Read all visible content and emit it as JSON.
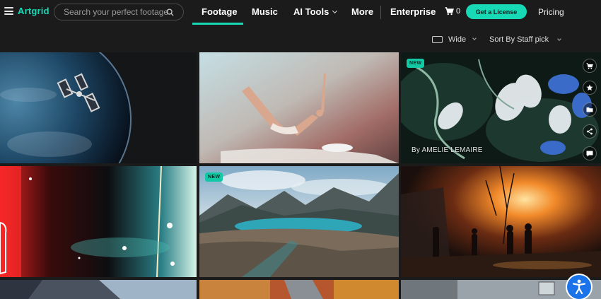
{
  "header": {
    "logo": "Artgrid",
    "search_placeholder": "Search your perfect footage",
    "nav": [
      {
        "label": "Footage",
        "active": true
      },
      {
        "label": "Music"
      },
      {
        "label": "AI Tools"
      },
      {
        "label": "More"
      },
      {
        "label": "Enterprise"
      }
    ],
    "cart_count": "0",
    "license_button": "Get a License",
    "pricing": "Pricing"
  },
  "toolbar": {
    "view_label": "Wide",
    "sort_label": "Sort By Staff pick"
  },
  "tiles": [
    {
      "name": "space-station-earth"
    },
    {
      "name": "falling-woman"
    },
    {
      "name": "flowers-underwater",
      "badge": "NEW",
      "credit": "By AMELIE LEMAIRE"
    },
    {
      "name": "film-burn"
    },
    {
      "name": "mountain-lake",
      "badge": "NEW"
    },
    {
      "name": "firefighters"
    },
    {
      "name": "building-lookup"
    },
    {
      "name": "autumn-road"
    },
    {
      "name": "house-exterior"
    }
  ],
  "colors": {
    "accent": "#17d9b6",
    "background": "#1b1b1c",
    "accessibility": "#1a73e8"
  }
}
